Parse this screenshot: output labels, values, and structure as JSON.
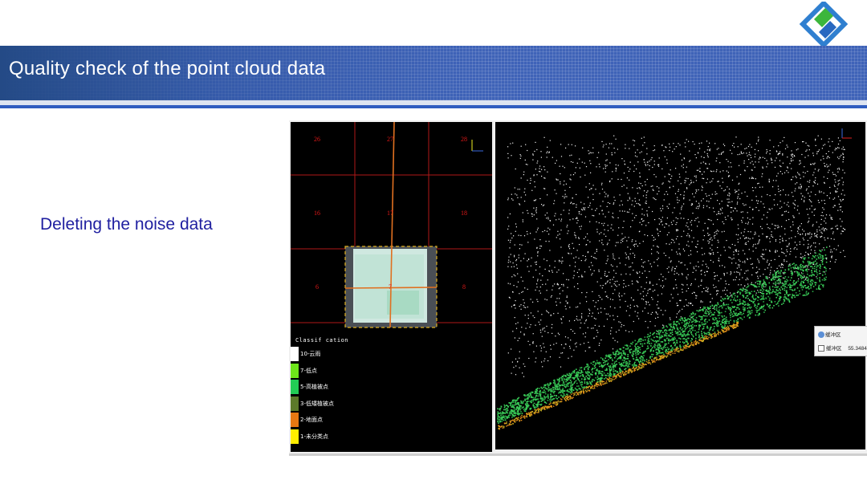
{
  "slide": {
    "title": "Quality check of the point cloud data",
    "subtitle": "Deleting the noise data"
  },
  "colors": {
    "title_bar": "#3f63b8",
    "subtitle_text": "#1f1fa0",
    "tile_label": "#e01818",
    "flight_line": "#e07020"
  },
  "tile_map": {
    "tiles": [
      "26",
      "27",
      "28",
      "16",
      "17",
      "18",
      "6",
      "7",
      "8"
    ]
  },
  "classification": {
    "title": "Classif cation",
    "items": [
      {
        "label": "10-云雨",
        "color": "#ffffff"
      },
      {
        "label": "7-低点",
        "color": "#6ee61a"
      },
      {
        "label": "5-高植被点",
        "color": "#22cc55"
      },
      {
        "label": "3-低矮植被点",
        "color": "#5c7a2a"
      },
      {
        "label": "2-地面点",
        "color": "#e87812"
      },
      {
        "label": "1-未分类点",
        "color": "#ffee00"
      }
    ]
  },
  "side_widget": {
    "line1": "缓冲区",
    "line2_label": "缓冲区",
    "line2_value": "55.3484"
  }
}
